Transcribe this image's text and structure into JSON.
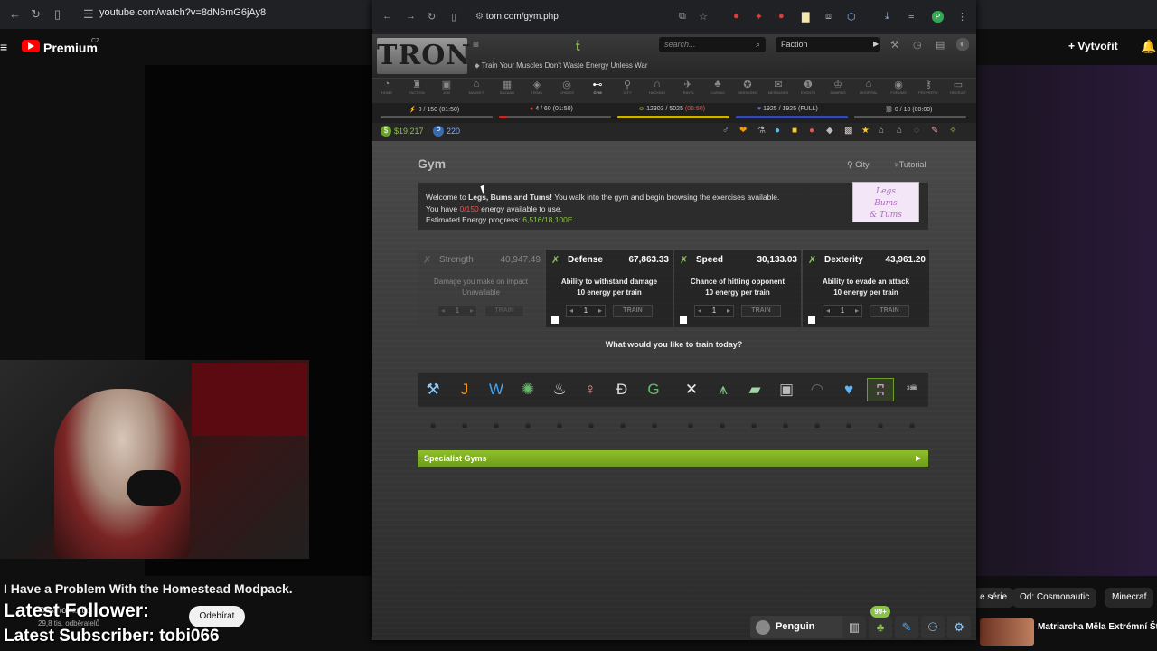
{
  "youtube": {
    "url": "youtube.com/watch?v=8dN6mG6jAy8",
    "logo_text": "Premium",
    "logo_region": "CZ",
    "create_label": "Vytvořit",
    "video_title": "I Have a Problem With the Homestead Modpack.",
    "channel_name": "Cosmonautic",
    "subscribers": "29,8 tis. odběratelů",
    "subscribe_label": "Odebírat",
    "overlay_follower": "Latest Follower:",
    "overlay_subscriber": "Latest Subscriber: tobi066",
    "chips": [
      "e série",
      "Od: Cosmonautic",
      "Minecraf"
    ],
    "recommended_title": "Matriarcha Měla Extrémní Št"
  },
  "browser": {
    "url": "torn.com/gym.php"
  },
  "torn": {
    "logo": "TRON",
    "search_placeholder": "search...",
    "faction_label": "Faction",
    "tagline": "Train Your Muscles Don't Waste Energy Unless War",
    "nav": [
      "HOME",
      "FACTION",
      "JOB",
      "MARKET",
      "BAZAAR",
      "ITEMS",
      "CRIMES",
      "GYM",
      "CITY",
      "HACKING",
      "TRAVEL",
      "CASINO",
      "MISSIONS",
      "MESSAGES",
      "EVENTS",
      "AWARDS",
      "HOSPITAL",
      "FORUMS",
      "PROPERTY",
      "RECRUIT"
    ],
    "bars": {
      "energy": "0 / 150 (01:50)",
      "nerve": "4 / 60 (01:50)",
      "happy": "12303 / 5025",
      "happy_timer": "(06:50)",
      "life": "1925 / 1925 (FULL)",
      "chain": "0 / 10 (00:00)"
    },
    "money": "$19,217",
    "points": "220",
    "gym": {
      "title": "Gym",
      "city_link": "City",
      "tutorial_link": "Tutorial",
      "welcome_prefix": "Welcome to ",
      "gym_name": "Legs, Bums and Tums!",
      "welcome_suffix": " You walk into the gym and begin browsing the exercises available.",
      "energy_prefix": "You have ",
      "energy_value": "0/150",
      "energy_suffix": " energy available to use.",
      "progress_label": "Estimated Energy progress: ",
      "progress_value": "6,516/18,100E.",
      "badge_line1": "Legs",
      "badge_line2": "Bums",
      "badge_line3": "& Tums",
      "question": "What would you like to train today?",
      "specialist_label": "Specialist Gyms",
      "gym_percent": "38%"
    },
    "stats": [
      {
        "name": "Strength",
        "value": "40,947.49",
        "desc": "Damage you make on impact",
        "cost": "Unavailable",
        "qty": "1",
        "train": "TRAIN"
      },
      {
        "name": "Defense",
        "value": "67,863.33",
        "desc": "Ability to withstand damage",
        "cost": "10 energy per train",
        "qty": "1",
        "train": "TRAIN"
      },
      {
        "name": "Speed",
        "value": "30,133.03",
        "desc": "Chance of hitting opponent",
        "cost": "10 energy per train",
        "qty": "1",
        "train": "TRAIN"
      },
      {
        "name": "Dexterity",
        "value": "43,961.20",
        "desc": "Ability to evade an attack",
        "cost": "10 energy per train",
        "qty": "1",
        "train": "TRAIN"
      }
    ],
    "chat": {
      "user": "Penguin",
      "badge": "99+"
    }
  }
}
